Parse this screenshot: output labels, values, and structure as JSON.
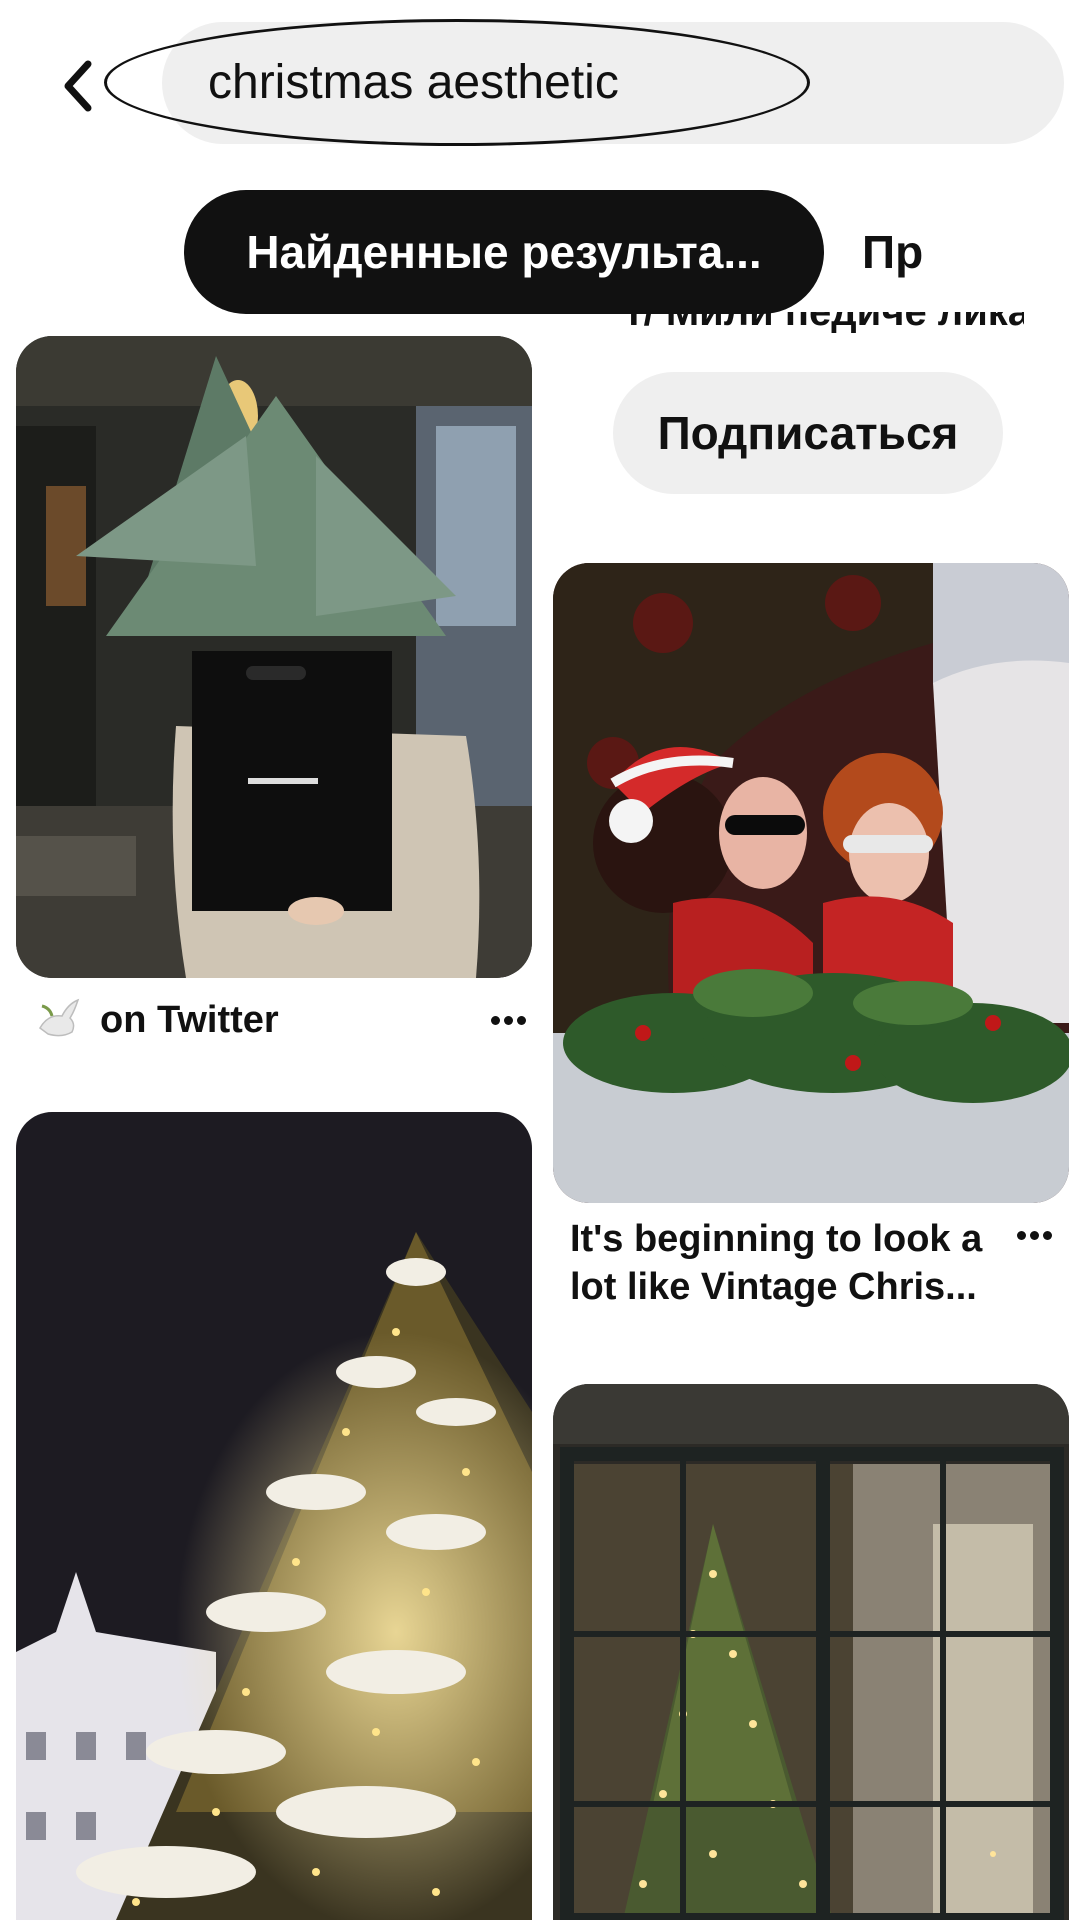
{
  "search": {
    "query": "christmas aesthetic",
    "back_icon": "chevron-left-icon"
  },
  "tabs": [
    {
      "label": "Найденные результа...",
      "active": true
    },
    {
      "label": "Пр",
      "active": false
    }
  ],
  "profile_card": {
    "cut_text": "т/ Мили педиче лика",
    "subscribe_label": "Подписаться"
  },
  "pins": [
    {
      "id": "pin-bag-tree",
      "source_label": "on Twitter",
      "source_icon": "dove-icon",
      "more_icon": "more-dots-icon"
    },
    {
      "id": "pin-vintage",
      "title": "It's beginning to look a lot like Vintage Chris...",
      "more_icon": "more-dots-icon"
    },
    {
      "id": "pin-snow-tree"
    },
    {
      "id": "pin-window-tree"
    }
  ],
  "colors": {
    "active_tab_bg": "#111111",
    "chip_bg": "#efefef",
    "text": "#111111"
  }
}
